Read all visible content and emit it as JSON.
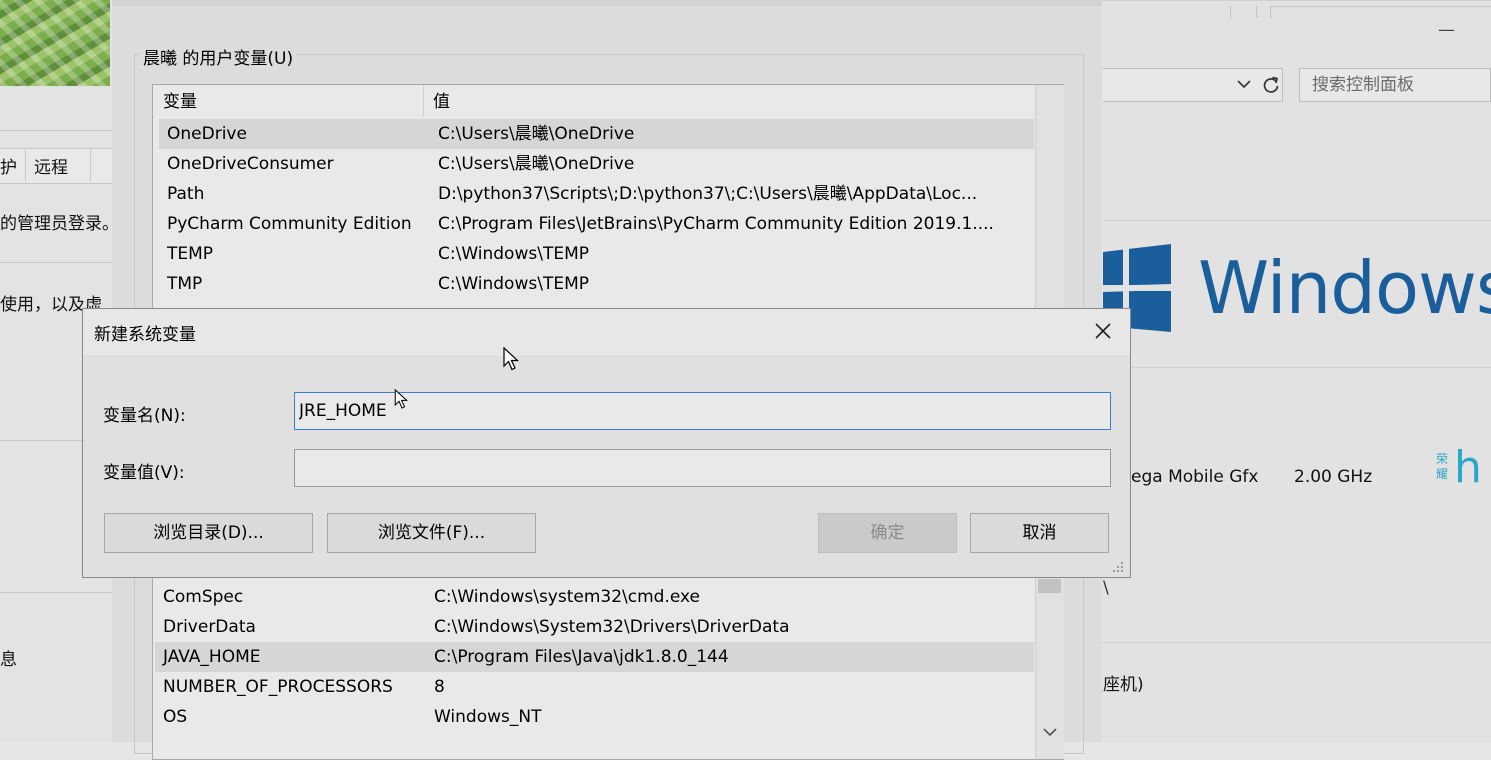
{
  "background_left": {
    "tabs": [
      "护",
      "远程"
    ],
    "text_1": "的管理员登录。",
    "text_2": "使用，以及虚",
    "text_3": "息"
  },
  "background_right": {
    "minimize_glyph": "—",
    "search_placeholder": "搜索控制面板",
    "windows_logo_text": "Windows",
    "processor_text": "ega Mobile Gfx",
    "processor_speed": "2.00 GHz",
    "brand_text": "荣耀",
    "brand_partial": "h",
    "mode_text": "座机)",
    "misc_glyph": "\\"
  },
  "env_dialog": {
    "user_vars_title": "晨曦 的用户变量(U)",
    "user_vars_headers": [
      "变量",
      "值"
    ],
    "user_vars": [
      {
        "name": "OneDrive",
        "value": "C:\\Users\\晨曦\\OneDrive"
      },
      {
        "name": "OneDriveConsumer",
        "value": "C:\\Users\\晨曦\\OneDrive"
      },
      {
        "name": "Path",
        "value": "D:\\python37\\Scripts\\;D:\\python37\\;C:\\Users\\晨曦\\AppData\\Loc..."
      },
      {
        "name": "PyCharm Community Edition",
        "value": "C:\\Program Files\\JetBrains\\PyCharm Community Edition 2019.1...."
      },
      {
        "name": "TEMP",
        "value": "C:\\Windows\\TEMP"
      },
      {
        "name": "TMP",
        "value": "C:\\Windows\\TEMP"
      }
    ],
    "user_vars_selected_index": 0,
    "system_vars": [
      {
        "name": "ComSpec",
        "value": "C:\\Windows\\system32\\cmd.exe"
      },
      {
        "name": "DriverData",
        "value": "C:\\Windows\\System32\\Drivers\\DriverData"
      },
      {
        "name": "JAVA_HOME",
        "value": "C:\\Program Files\\Java\\jdk1.8.0_144"
      },
      {
        "name": "NUMBER_OF_PROCESSORS",
        "value": "8"
      },
      {
        "name": "OS",
        "value": "Windows_NT"
      }
    ],
    "system_vars_selected_index": 2
  },
  "new_var_dialog": {
    "title": "新建系统变量",
    "close_glyph": "✕",
    "name_label": "变量名(N):",
    "name_value": "JRE_HOME",
    "value_label": "变量值(V):",
    "value_value": "",
    "browse_dir_label": "浏览目录(D)...",
    "browse_file_label": "浏览文件(F)...",
    "ok_label": "确定",
    "cancel_label": "取消"
  },
  "colors": {
    "windows_blue": "#1a5f9c",
    "focus_border": "#3a7bd5",
    "brand_teal": "#2aa6c8"
  }
}
